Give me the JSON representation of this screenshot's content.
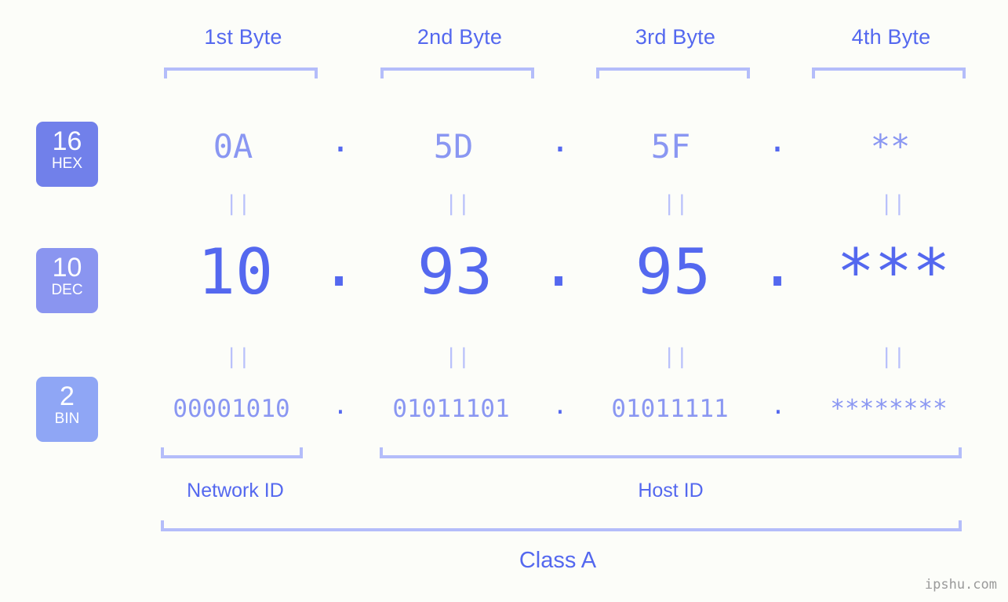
{
  "meta": {
    "background_color": "#fcfdf9",
    "accent_strong": "#5468ef",
    "accent_mid": "#8a97f2",
    "accent_light": "#b4bdfa",
    "watermark": "ipshu.com"
  },
  "headers": [
    {
      "label": "1st Byte"
    },
    {
      "label": "2nd Byte"
    },
    {
      "label": "3rd Byte"
    },
    {
      "label": "4th Byte"
    }
  ],
  "bases": [
    {
      "number": "16",
      "name": "HEX",
      "color": "#7180ea"
    },
    {
      "number": "10",
      "name": "DEC",
      "color": "#8a95f0"
    },
    {
      "number": "2",
      "name": "BIN",
      "color": "#8fa6f5"
    }
  ],
  "rows": {
    "hex": {
      "values": [
        "0A",
        "5D",
        "5F",
        "**"
      ],
      "separator": "."
    },
    "dec": {
      "values": [
        "10",
        "93",
        "95",
        "***"
      ],
      "separator": "."
    },
    "bin": {
      "values": [
        "00001010",
        "01011101",
        "01011111",
        "********"
      ],
      "separator": "."
    }
  },
  "equality_marks": {
    "glyph": "||",
    "rows": [
      "hex-to-dec",
      "dec-to-bin"
    ]
  },
  "sections": [
    {
      "label": "Network ID"
    },
    {
      "label": "Host ID"
    }
  ],
  "class": {
    "label": "Class A"
  }
}
